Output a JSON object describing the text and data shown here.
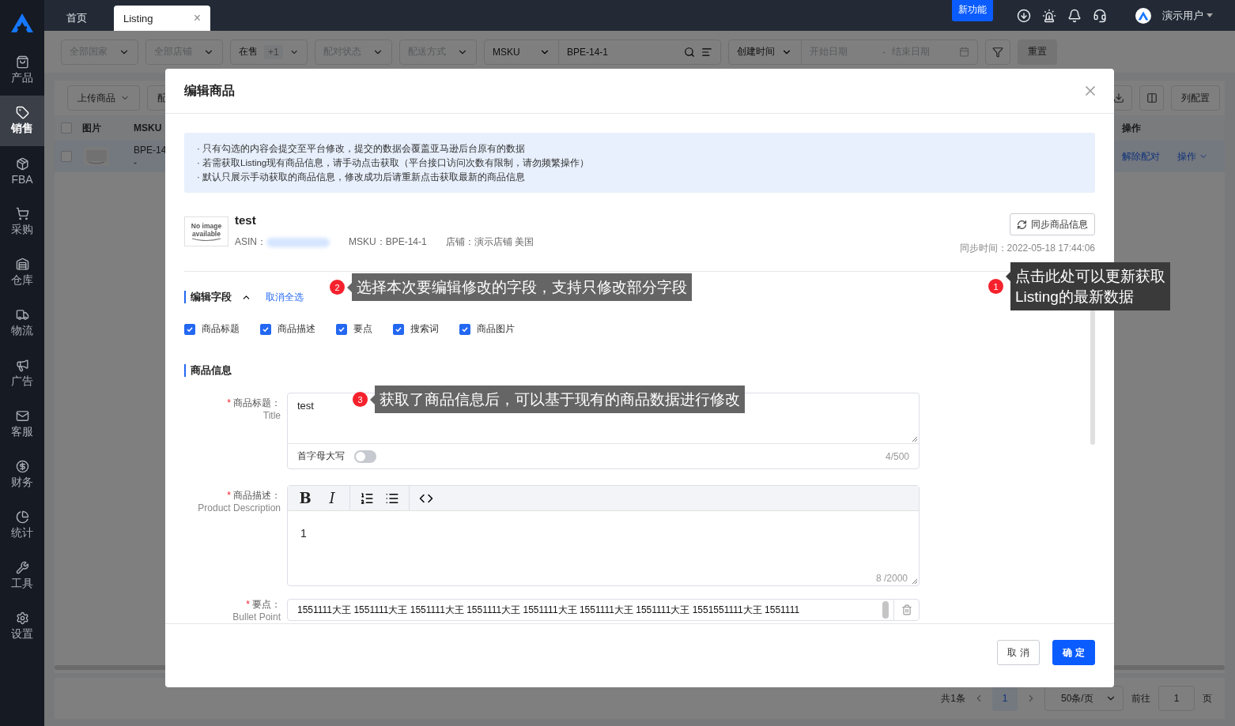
{
  "sidebar": {
    "items": [
      {
        "label": "产品",
        "selected": false
      },
      {
        "label": "销售",
        "selected": true
      },
      {
        "label": "FBA",
        "selected": false
      },
      {
        "label": "采购",
        "selected": false
      },
      {
        "label": "仓库",
        "selected": false
      },
      {
        "label": "物流",
        "selected": false
      },
      {
        "label": "广告",
        "selected": false
      },
      {
        "label": "客服",
        "selected": false
      },
      {
        "label": "财务",
        "selected": false
      },
      {
        "label": "统计",
        "selected": false
      },
      {
        "label": "工具",
        "selected": false
      },
      {
        "label": "设置",
        "selected": false
      }
    ]
  },
  "top_bar": {
    "tabs": [
      {
        "label": "首页",
        "selected": false,
        "closable": false
      },
      {
        "label": "Listing",
        "selected": true,
        "closable": true
      }
    ],
    "close_mark": "×",
    "new_feature_badge": "新功能",
    "user": "演示用户"
  },
  "filters": [
    {
      "kind": "select",
      "placeholder": "全部国家"
    },
    {
      "kind": "select",
      "placeholder": "全部店铺"
    },
    {
      "kind": "select",
      "value": "在售",
      "extra": "+1"
    },
    {
      "kind": "select",
      "placeholder": "配对状态"
    },
    {
      "kind": "select",
      "placeholder": "配送方式"
    },
    {
      "kind": "search",
      "field": "MSKU",
      "value": "BPE-14-1"
    },
    {
      "kind": "date",
      "field": "创建时间",
      "start_placeholder": "开始日期",
      "separator": "-",
      "end_placeholder": "结束日期"
    }
  ],
  "reset_button": "重置",
  "actions": {
    "upload_button": "上传商品",
    "pair_button": "配",
    "column_button": "列配置"
  },
  "table": {
    "header_checked": false,
    "columns": [
      "图片",
      "MSKU",
      "操作"
    ],
    "rows": [
      {
        "checked": false,
        "msku": "BPE-14",
        "msku_sub": "-",
        "unpair_link": "解除配对",
        "action_link": "操作"
      }
    ]
  },
  "pagination": {
    "total": "共1条",
    "pages": [
      {
        "label": "1",
        "selected": true
      }
    ],
    "page_size": "50条/页",
    "goto_label": "前往",
    "goto_value": "1",
    "page_unit": "页"
  },
  "modal": {
    "title": "编辑商品",
    "notices": [
      "· 只有勾选的内容会提交至平台修改，提交的数据会覆盖亚马逊后台原有的数据",
      "· 若需获取Listing现有商品信息，请手动点击获取（平台接口访问次数有限制，请勿频繁操作）",
      "· 默认只展示手动获取的商品信息，修改成功后请重新点击获取最新的商品信息"
    ],
    "product": {
      "thumbnail_text": "No image available",
      "name": "test",
      "asin_label": "ASIN：",
      "msku": "MSKU：BPE-14-1",
      "store": "店铺：演示店铺 美国",
      "sync_button": "同步商品信息",
      "sync_time": "同步时间：2022-05-18 17:44:06"
    },
    "edit_fields": {
      "title": "编辑字段",
      "expanded": true,
      "deselect_all": "取消全选",
      "options": [
        {
          "label": "商品标题",
          "checked": true
        },
        {
          "label": "商品描述",
          "checked": true
        },
        {
          "label": "要点",
          "checked": true
        },
        {
          "label": "搜索词",
          "checked": true
        },
        {
          "label": "商品图片",
          "checked": true
        }
      ]
    },
    "info_title": "商品信息",
    "fields": [
      {
        "kind": "textarea",
        "required_mark": "*",
        "label": "商品标题",
        "colon": "：",
        "sublabel": "Title",
        "value": "test",
        "toggle": {
          "label": "首字母大写",
          "on": false
        },
        "counter": "4/500"
      },
      {
        "kind": "rich_text",
        "required_mark": "*",
        "label": "商品描述",
        "colon": "：",
        "sublabel": "Product Description",
        "format_buttons": [
          {
            "kind": "bold",
            "label": "B"
          },
          {
            "kind": "italic",
            "label": "I"
          }
        ],
        "value": "1",
        "counter": "8 /2000"
      },
      {
        "kind": "bullet",
        "required_mark": "*",
        "label": "要点",
        "colon": "：",
        "sublabel": "Bullet Point",
        "value": "1551111大王 1551111大王 1551111大王 1551111大王 1551111大王 1551111大王 1551111大王 1551551111大王 1551111"
      }
    ],
    "cancel_button": "取 消",
    "ok_button": "确 定"
  },
  "callouts": [
    {
      "number": "2",
      "text": "选择本次要编辑修改的字段，支持只修改部分字段"
    },
    {
      "number": "1",
      "text": "点击此处可以更新获取\nListing的最新数据"
    },
    {
      "number": "3",
      "text": "获取了商品信息后，可以基于现有的商品数据进行修改"
    }
  ]
}
